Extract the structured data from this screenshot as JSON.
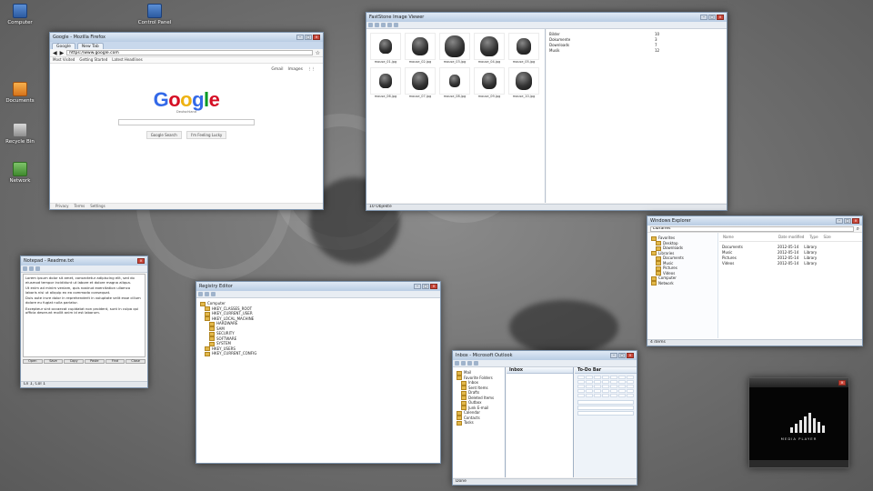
{
  "desktop": {
    "icons": [
      {
        "label": "Computer"
      },
      {
        "label": "Documents"
      },
      {
        "label": "Recycle Bin"
      },
      {
        "label": "Network"
      },
      {
        "label": "Control Panel"
      }
    ]
  },
  "browser": {
    "title": "Google - Mozilla Firefox",
    "tabs": [
      "Google",
      "New Tab"
    ],
    "url": "https://www.google.com",
    "bookmarks": [
      "Most Visited",
      "Getting Started",
      "Latest Headlines"
    ],
    "top_links": [
      "Gmail",
      "Images"
    ],
    "logo_sub": "Deutschland",
    "buttons": [
      "Google Search",
      "I'm Feeling Lucky"
    ],
    "footer": [
      "Privacy",
      "Terms",
      "Settings"
    ]
  },
  "image_viewer": {
    "title": "FastStone Image Viewer",
    "thumbs": [
      "mouse_01.jpg",
      "mouse_02.jpg",
      "mouse_03.jpg",
      "mouse_04.jpg",
      "mouse_05.jpg",
      "mouse_06.jpg",
      "mouse_07.jpg",
      "mouse_08.jpg",
      "mouse_09.jpg",
      "mouse_10.jpg"
    ],
    "files": [
      {
        "name": "Bilder",
        "count": "10"
      },
      {
        "name": "Dokumente",
        "count": "3"
      },
      {
        "name": "Downloads",
        "count": "7"
      },
      {
        "name": "Musik",
        "count": "12"
      }
    ],
    "status": "10 Objekte"
  },
  "editor": {
    "title": "Notepad - Readme.txt",
    "lines": [
      "Lorem ipsum dolor sit amet, consectetur adipiscing elit, sed do eiusmod tempor incididunt ut labore et dolore magna aliqua.",
      "Ut enim ad minim veniam, quis nostrud exercitation ullamco laboris nisi ut aliquip ex ea commodo consequat.",
      "Duis aute irure dolor in reprehenderit in voluptate velit esse cillum dolore eu fugiat nulla pariatur.",
      "Excepteur sint occaecat cupidatat non proident, sunt in culpa qui officia deserunt mollit anim id est laborum."
    ],
    "buttons": [
      "Open",
      "Save",
      "Copy",
      "Paste",
      "Find",
      "Close"
    ],
    "status": "Ln 1, Col 1"
  },
  "registry": {
    "title": "Registry Editor",
    "nodes": [
      "Computer",
      "HKEY_CLASSES_ROOT",
      "HKEY_CURRENT_USER",
      "HKEY_LOCAL_MACHINE",
      "HARDWARE",
      "SAM",
      "SECURITY",
      "SOFTWARE",
      "SYSTEM",
      "HKEY_USERS",
      "HKEY_CURRENT_CONFIG"
    ]
  },
  "explorer": {
    "title": "Windows Explorer",
    "address": "Libraries",
    "sidebar": [
      "Favorites",
      "Desktop",
      "Downloads",
      "Libraries",
      "Documents",
      "Music",
      "Pictures",
      "Videos",
      "Computer",
      "Network"
    ],
    "columns": [
      "Name",
      "Date modified",
      "Type",
      "Size"
    ],
    "files": [
      {
        "name": "Documents",
        "date": "2012-05-14",
        "type": "Library",
        "size": ""
      },
      {
        "name": "Music",
        "date": "2012-05-14",
        "type": "Library",
        "size": ""
      },
      {
        "name": "Pictures",
        "date": "2012-05-14",
        "type": "Library",
        "size": ""
      },
      {
        "name": "Videos",
        "date": "2012-05-14",
        "type": "Library",
        "size": ""
      }
    ],
    "status": "4 items"
  },
  "mail": {
    "title": "Inbox - Microsoft Outlook",
    "folders": [
      "Mail",
      "Favorite Folders",
      "Inbox",
      "Sent Items",
      "Drafts",
      "Deleted Items",
      "Outbox",
      "Junk E-mail",
      "Calendar",
      "Contacts",
      "Tasks"
    ],
    "mid_header": "Inbox",
    "right_header": "To-Do Bar",
    "status": "Done"
  },
  "player": {
    "caption": "MEDIA PLAYER"
  }
}
